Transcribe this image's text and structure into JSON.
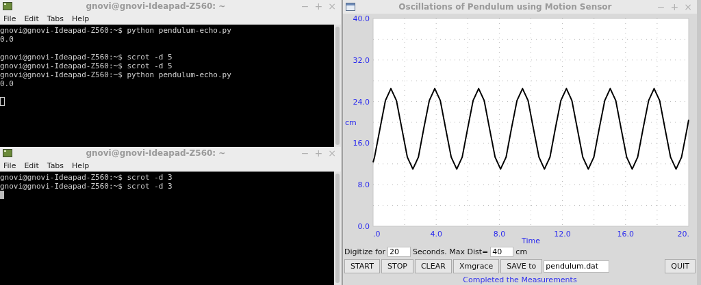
{
  "terminals": [
    {
      "title": "gnovi@gnovi-Ideapad-Z560: ~",
      "controls": [
        "−",
        "+",
        "×"
      ],
      "menu": [
        "File",
        "Edit",
        "Tabs",
        "Help"
      ],
      "lines": [
        {
          "text": "gnovi@gnovi-Ideapad-Z560:~$ python pendulum-echo.py",
          "gap_after": false
        },
        {
          "text": "0.0",
          "gap_after": true
        },
        {
          "text": "gnovi@gnovi-Ideapad-Z560:~$ scrot -d 5",
          "gap_after": false
        },
        {
          "text": "gnovi@gnovi-Ideapad-Z560:~$ scrot -d 5",
          "gap_after": false
        },
        {
          "text": "gnovi@gnovi-Ideapad-Z560:~$ python pendulum-echo.py",
          "gap_after": false
        },
        {
          "text": "0.0",
          "gap_after": true
        }
      ],
      "cursor_focused": false
    },
    {
      "title": "gnovi@gnovi-Ideapad-Z560: ~",
      "controls": [
        "−",
        "+",
        "×"
      ],
      "menu": [
        "File",
        "Edit",
        "Tabs",
        "Help"
      ],
      "lines": [
        {
          "text": "gnovi@gnovi-Ideapad-Z560:~$ scrot -d 3",
          "gap_after": false
        },
        {
          "text": "gnovi@gnovi-Ideapad-Z560:~$ scrot -d 3",
          "gap_after": false
        }
      ],
      "cursor_focused": true
    }
  ],
  "plot_window": {
    "title": "Oscillations of Pendulum using Motion Sensor",
    "controls": [
      "−",
      "+",
      "×"
    ],
    "chart_data": {
      "type": "line",
      "grid": true,
      "xlabel": "Time",
      "ylabel": "cm",
      "xlim": [
        0,
        20
      ],
      "ylim": [
        0,
        40
      ],
      "xticks": [
        {
          "value": 0,
          "label": ".0"
        },
        {
          "value": 4,
          "label": "4.0"
        },
        {
          "value": 8,
          "label": "8.0"
        },
        {
          "value": 12,
          "label": "12.0"
        },
        {
          "value": 16,
          "label": "16.0"
        },
        {
          "value": 20,
          "label": "20."
        }
      ],
      "yticks": [
        {
          "value": 0,
          "label": "0.0"
        },
        {
          "value": 8,
          "label": "8.0"
        },
        {
          "value": 16,
          "label": "16.0"
        },
        {
          "value": 24,
          "label": "24.0"
        },
        {
          "value": 32,
          "label": "32.0"
        },
        {
          "value": 40,
          "label": "40.0"
        }
      ],
      "x": [
        0,
        0.09,
        0.44,
        0.78,
        1.13,
        1.48,
        1.82,
        2.17,
        2.52,
        2.87,
        3.21,
        3.56,
        3.91,
        4.26,
        4.6,
        4.95,
        5.3,
        5.65,
        5.99,
        6.34,
        6.69,
        7.04,
        7.38,
        7.73,
        8.08,
        8.43,
        8.77,
        9.12,
        9.47,
        9.82,
        10.16,
        10.51,
        10.86,
        11.21,
        11.55,
        11.9,
        12.25,
        12.6,
        12.94,
        13.29,
        13.64,
        13.99,
        14.33,
        14.68,
        15.03,
        15.38,
        15.72,
        16.07,
        16.42,
        16.77,
        17.11,
        17.46,
        17.81,
        18.16,
        18.5,
        18.85,
        19.2,
        19.55,
        19.9,
        20
      ],
      "series": [
        {
          "color": "#000000",
          "values": [
            12.3,
            13.3,
            18.8,
            24.2,
            26.5,
            24.2,
            18.8,
            13.3,
            11.0,
            13.3,
            18.8,
            24.2,
            26.5,
            24.2,
            18.8,
            13.3,
            11.0,
            13.3,
            18.8,
            24.2,
            26.5,
            24.2,
            18.8,
            13.3,
            11.0,
            13.3,
            18.8,
            24.2,
            26.5,
            24.2,
            18.8,
            13.3,
            11.0,
            13.3,
            18.8,
            24.2,
            26.5,
            24.2,
            18.8,
            13.3,
            11.0,
            13.3,
            18.8,
            24.2,
            26.5,
            24.2,
            18.8,
            13.3,
            11.0,
            13.3,
            18.8,
            24.2,
            26.5,
            24.2,
            18.8,
            13.3,
            11.0,
            13.3,
            18.8,
            20.5
          ]
        }
      ]
    },
    "digitize_label": "Digitize for",
    "seconds_value": "20",
    "maxdist_label": "Seconds. Max Dist=",
    "maxdist_value": "40",
    "unit_label": "cm",
    "buttons": [
      "START",
      "STOP",
      "CLEAR",
      "Xmgrace",
      "SAVE to"
    ],
    "filename": "pendulum.dat",
    "quit": "QUIT",
    "status": "Completed the Measurements"
  }
}
